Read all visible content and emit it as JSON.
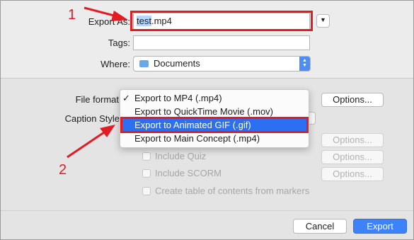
{
  "top": {
    "export_as_label": "Export As:",
    "filename_selected": "test",
    "filename_rest": ".mp4",
    "tags_label": "Tags:",
    "tags_value": "",
    "where_label": "Where:",
    "where_value": "Documents"
  },
  "format": {
    "file_format_label": "File format",
    "caption_style_label": "Caption Style",
    "options_label": "Options...",
    "menu": [
      {
        "label": "Export to MP4 (.mp4)",
        "checked": true
      },
      {
        "label": "Export to QuickTime Movie (.mov)",
        "checked": false
      },
      {
        "label": "Export to Animated GIF (.gif)",
        "checked": false
      },
      {
        "label": "Export to Main Concept (.mp4)",
        "checked": false
      }
    ],
    "check_mark": "✓"
  },
  "checkboxes": {
    "quiz": "Include Quiz",
    "scorm": "Include SCORM",
    "toc": "Create table of contents from markers"
  },
  "options_buttons": {
    "b1": "Options...",
    "b2": "Options...",
    "b3": "Options..."
  },
  "footer": {
    "cancel": "Cancel",
    "export": "Export"
  },
  "annotations": {
    "step1": "1",
    "step2": "2"
  },
  "colors": {
    "accent": "#2d6ff1",
    "annotation": "#e31b23"
  }
}
